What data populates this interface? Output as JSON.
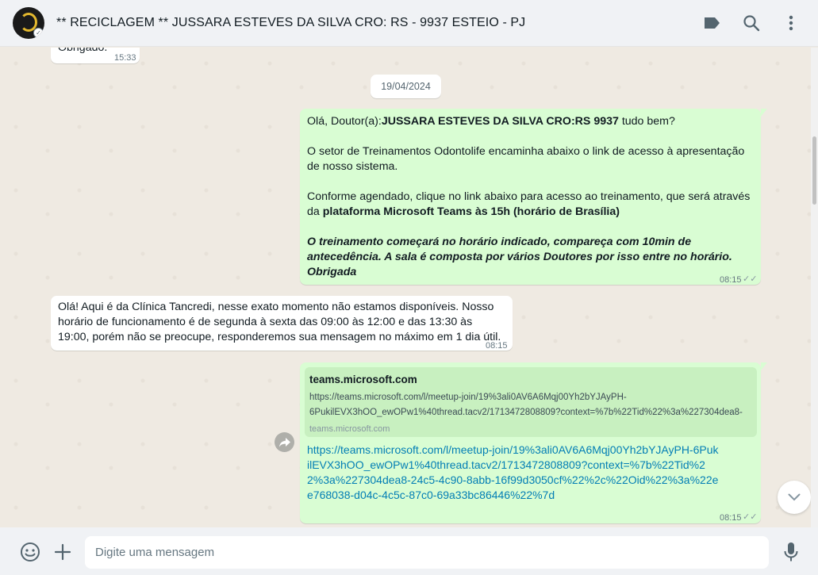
{
  "header": {
    "title": "** RECICLAGEM ** JUSSARA ESTEVES DA SILVA CRO: RS - 9937 ESTEIO  - PJ",
    "icons": [
      "label-icon",
      "search-icon",
      "menu-icon"
    ]
  },
  "messages": {
    "prev": {
      "text": "Obrigado.",
      "time": "15:33"
    },
    "date_chip": "19/04/2024",
    "outgoing1": {
      "greeting_a": "Olá, Doutor(a):",
      "greeting_name": "JUSSARA ESTEVES DA SILVA CRO:RS 9937",
      "greeting_b": " tudo bem?",
      "p2": "O setor de Treinamentos Odontolife encaminha abaixo o link de acesso à apresentação de nosso sistema.",
      "p3_a": "Conforme agendado, clique no link abaixo para acesso ao treinamento, que será através da ",
      "p3_b": "plataforma Microsoft Teams às 15h (horário de Brasília)",
      "p4": "O treinamento começará no horário indicado, compareça com 10min de antecedência. A sala é composta por vários Doutores por isso entre no horário. Obrigada",
      "time": "08:15"
    },
    "incoming1": {
      "text": "Olá! Aqui é da Clínica Tancredi, nesse exato momento não estamos disponíveis. Nosso horário de funcionamento é de segunda à sexta das 09:00 às 12:00 e das 13:30 às 19:00, porém não se preocupe, responderemos sua mensagem no máximo em 1 dia útil.",
      "time": "08:15"
    },
    "outgoing2": {
      "preview_site": "teams.microsoft.com",
      "preview_desc1": "https://teams.microsoft.com/l/meetup-join/19%3ali0AV6A6Mqj00Yh2bYJAyPH-",
      "preview_desc2": "6PukilEVX3hOO_ewOPw1%40thread.tacv2/1713472808809?context=%7b%22Tid%22%3a%227304dea8-",
      "preview_domain": "teams.microsoft.com",
      "link": "https://teams.microsoft.com/l/meetup-join/19%3ali0AV6A6Mqj00Yh2bYJAyPH-6PukilEVX3hOO_ewOPw1%40thread.tacv2/1713472808809?context=%7b%22Tid%22%3a%227304dea8-24c5-4c90-8abb-16f99d3050cf%22%2c%22Oid%22%3a%22ee768038-d04c-4c5c-87c0-69a33bc86446%22%7d",
      "time": "08:15"
    }
  },
  "footer": {
    "placeholder": "Digite uma mensagem"
  },
  "colors": {
    "outgoing_bubble": "#d9fdd3",
    "incoming_bubble": "#ffffff",
    "chat_background": "#efeae2",
    "link": "#027eb5"
  }
}
